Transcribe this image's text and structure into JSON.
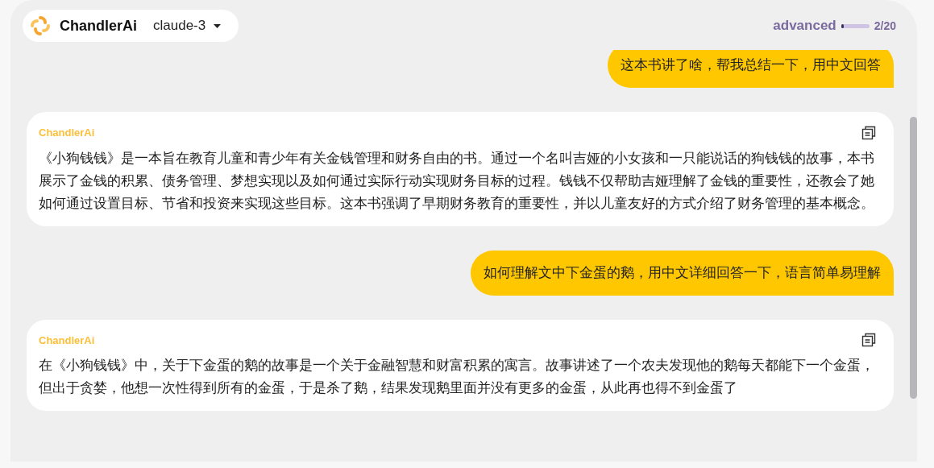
{
  "header": {
    "app_name": "ChandlerAi",
    "model": "claude-3",
    "mode": "advanced",
    "usage": {
      "level": 0.1,
      "reading": "2/20"
    }
  },
  "messages": [
    {
      "kind": "user",
      "text": "这本书讲了啥，帮我总结一下，用中文回答"
    },
    {
      "kind": "assistant",
      "sender": "ChandlerAi",
      "text": "《小狗钱钱》是一本旨在教育儿童和青少年有关金钱管理和财务自由的书。通过一个名叫吉娅的小女孩和一只能说话的狗钱钱的故事，本书展示了金钱的积累、债务管理、梦想实现以及如何通过实际行动实现财务目标的过程。钱钱不仅帮助吉娅理解了金钱的重要性，还教会了她如何通过设置目标、节省和投资来实现这些目标。这本书强调了早期财务教育的重要性，并以儿童友好的方式介绍了财务管理的基本概念。"
    },
    {
      "kind": "user",
      "text": "如何理解文中下金蛋的鹅，用中文详细回答一下，语言简单易理解"
    },
    {
      "kind": "assistant",
      "sender": "ChandlerAi",
      "text": "在《小狗钱钱》中，关于下金蛋的鹅的故事是一个关于金融智慧和财富积累的寓言。故事讲述了一个农夫发现他的鹅每天都能下一个金蛋，但出于贪婪，他想一次性得到所有的金蛋，于是杀了鹅，结果发现鹅里面并没有更多的金蛋，从此再也得不到金蛋了"
    }
  ]
}
